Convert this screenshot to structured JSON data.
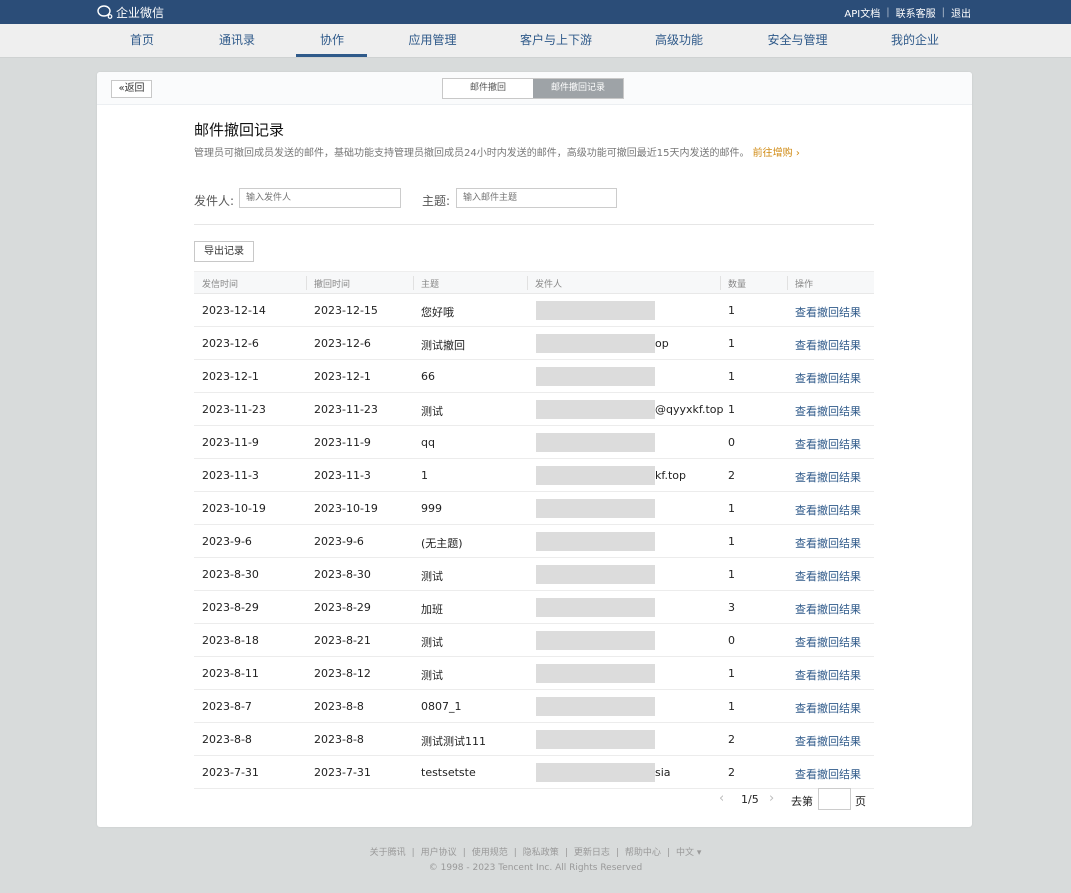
{
  "topbar": {
    "logo_text": "企业微信",
    "links": [
      "API文档",
      "联系客服",
      "退出"
    ]
  },
  "nav": {
    "items": [
      "首页",
      "通讯录",
      "协作",
      "应用管理",
      "客户与上下游",
      "高级功能",
      "安全与管理",
      "我的企业"
    ],
    "active": "协作"
  },
  "panel": {
    "back_label": "返回",
    "tabs": [
      "邮件撤回",
      "邮件撤回记录"
    ],
    "active_tab": "邮件撤回记录"
  },
  "page": {
    "title": "邮件撤回记录",
    "description": "管理员可撤回成员发送的邮件，基础功能支持管理员撤回成员24小时内发送的邮件，高级功能可撤回最近15天内发送的邮件。",
    "upgrade_link": "前往增购"
  },
  "filters": {
    "sender_label": "发件人:",
    "sender_placeholder": "输入发件人",
    "subject_label": "主题:",
    "subject_placeholder": "输入邮件主题"
  },
  "export_label": "导出记录",
  "table": {
    "columns": [
      "发信时间",
      "撤回时间",
      "主题",
      "发件人",
      "数量",
      "操作"
    ],
    "action_label": "查看撤回结果",
    "rows": [
      {
        "sent": "2023-12-14",
        "recalled": "2023-12-15",
        "subject": "您好哦",
        "sender_tail": "",
        "count": "1"
      },
      {
        "sent": "2023-12-6",
        "recalled": "2023-12-6",
        "subject": "测试撤回",
        "sender_tail": "op",
        "count": "1"
      },
      {
        "sent": "2023-12-1",
        "recalled": "2023-12-1",
        "subject": "66",
        "sender_tail": "",
        "count": "1"
      },
      {
        "sent": "2023-11-23",
        "recalled": "2023-11-23",
        "subject": "测试",
        "sender_tail": "@qyyxkf.top",
        "count": "1"
      },
      {
        "sent": "2023-11-9",
        "recalled": "2023-11-9",
        "subject": "qq",
        "sender_tail": "",
        "count": "0"
      },
      {
        "sent": "2023-11-3",
        "recalled": "2023-11-3",
        "subject": "1",
        "sender_tail": "kf.top",
        "count": "2"
      },
      {
        "sent": "2023-10-19",
        "recalled": "2023-10-19",
        "subject": "999",
        "sender_tail": "",
        "count": "1"
      },
      {
        "sent": "2023-9-6",
        "recalled": "2023-9-6",
        "subject": "(无主题)",
        "sender_tail": "",
        "count": "1"
      },
      {
        "sent": "2023-8-30",
        "recalled": "2023-8-30",
        "subject": "测试",
        "sender_tail": "",
        "count": "1"
      },
      {
        "sent": "2023-8-29",
        "recalled": "2023-8-29",
        "subject": "加班",
        "sender_tail": "",
        "count": "3"
      },
      {
        "sent": "2023-8-18",
        "recalled": "2023-8-21",
        "subject": "测试",
        "sender_tail": "",
        "count": "0"
      },
      {
        "sent": "2023-8-11",
        "recalled": "2023-8-12",
        "subject": "测试",
        "sender_tail": "",
        "count": "1"
      },
      {
        "sent": "2023-8-7",
        "recalled": "2023-8-8",
        "subject": "0807_1",
        "sender_tail": "",
        "count": "1"
      },
      {
        "sent": "2023-8-8",
        "recalled": "2023-8-8",
        "subject": "测试测试111",
        "sender_tail": "",
        "count": "2"
      },
      {
        "sent": "2023-7-31",
        "recalled": "2023-7-31",
        "subject": "testsetste",
        "sender_tail": "sia",
        "count": "2"
      }
    ]
  },
  "pager": {
    "page_info": "1/5",
    "goto_prefix": "去第",
    "goto_suffix": "页"
  },
  "footer": {
    "links": [
      "关于腾讯",
      "用户协议",
      "使用规范",
      "隐私政策",
      "更新日志",
      "帮助中心",
      "中文 ▾"
    ],
    "copyright": "© 1998 - 2023 Tencent Inc. All Rights Reserved"
  }
}
